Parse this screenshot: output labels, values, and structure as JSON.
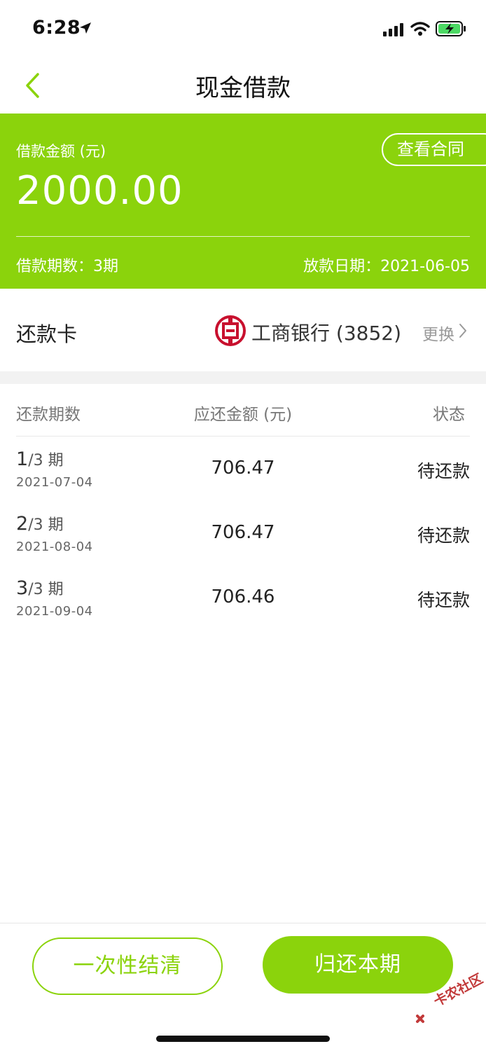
{
  "status_bar": {
    "time": "6:28",
    "icons": [
      "location-arrow-icon",
      "signal-icon",
      "wifi-icon",
      "battery-charging-icon"
    ]
  },
  "nav": {
    "title": "现金借款",
    "back_icon": "chevron-left-icon"
  },
  "loan": {
    "amount_label": "借款金额 (元)",
    "amount": "2000.00",
    "contract_button": "查看合同",
    "term_text": "借款期数：3期",
    "date_text": "放款日期：2021-06-05"
  },
  "repay_card": {
    "label": "还款卡",
    "bank": "工商银行 (3852)",
    "change": "更换"
  },
  "table": {
    "headers": [
      "还款期数",
      "应还金额 (元)",
      "状态"
    ],
    "rows": [
      {
        "period_num": "1",
        "period_suffix": "/3 期",
        "date": "2021-07-04",
        "amount": "706.47",
        "status": "待还款"
      },
      {
        "period_num": "2",
        "period_suffix": "/3 期",
        "date": "2021-08-04",
        "amount": "706.47",
        "status": "待还款"
      },
      {
        "period_num": "3",
        "period_suffix": "/3 期",
        "date": "2021-09-04",
        "amount": "706.46",
        "status": "待还款"
      }
    ]
  },
  "actions": {
    "settle_all": "一次性结清",
    "repay_current": "归还本期"
  },
  "watermark": {
    "text": "卡农社区"
  },
  "colors": {
    "brand_green": "#8bd30c",
    "bank_red": "#c8102e"
  }
}
